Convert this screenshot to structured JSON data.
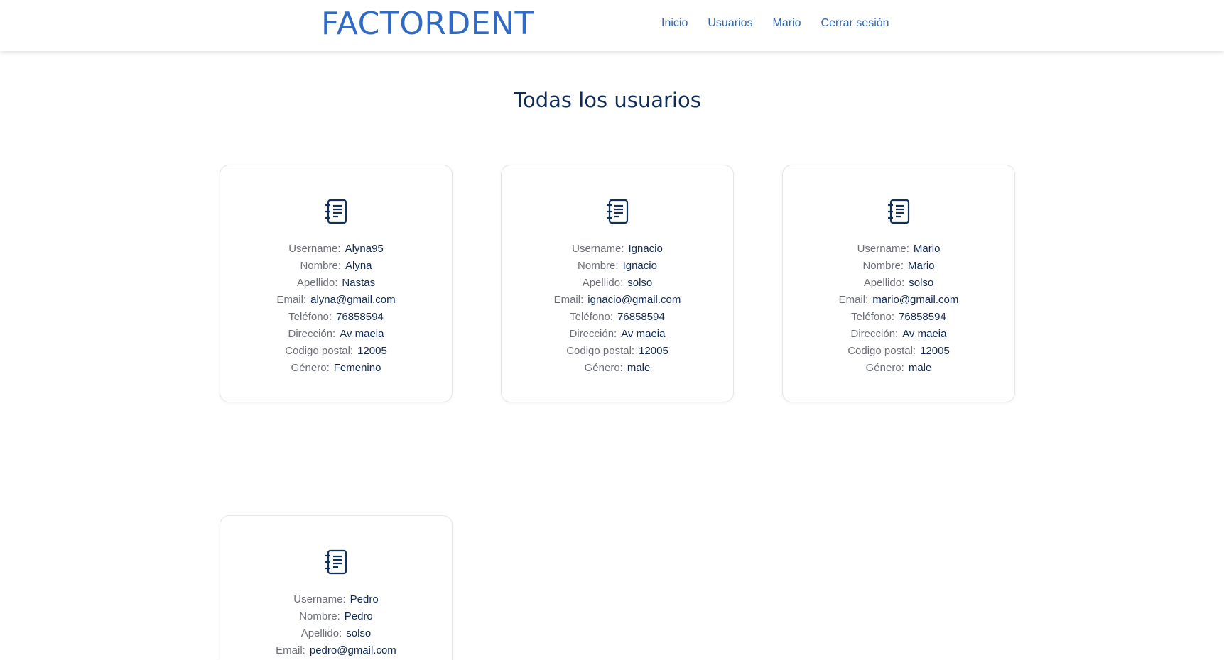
{
  "navbar": {
    "brand": "FACTORDENT",
    "links": [
      "Inicio",
      "Usuarios",
      "Mario",
      "Cerrar sesión"
    ]
  },
  "page": {
    "title": "Todas los usuarios"
  },
  "labels": {
    "username": "Username:",
    "nombre": "Nombre:",
    "apellido": "Apellido:",
    "email": "Email:",
    "telefono": "Teléfono:",
    "direccion": "Dirección:",
    "codigo_postal": "Codigo postal:",
    "genero": "Género:"
  },
  "users": [
    {
      "username": "Alyna95",
      "nombre": "Alyna",
      "apellido": "Nastas",
      "email": "alyna@gmail.com",
      "telefono": "76858594",
      "direccion": "Av maeia",
      "codigo_postal": "12005",
      "genero": "Femenino"
    },
    {
      "username": "Ignacio",
      "nombre": "Ignacio",
      "apellido": "solso",
      "email": "ignacio@gmail.com",
      "telefono": "76858594",
      "direccion": "Av maeia",
      "codigo_postal": "12005",
      "genero": "male"
    },
    {
      "username": "Mario",
      "nombre": "Mario",
      "apellido": "solso",
      "email": "mario@gmail.com",
      "telefono": "76858594",
      "direccion": "Av maeia",
      "codigo_postal": "12005",
      "genero": "male"
    },
    {
      "username": "Pedro",
      "nombre": "Pedro",
      "apellido": "solso",
      "email": "pedro@gmail.com"
    }
  ],
  "icons": {
    "card_icon": "notebook-icon"
  },
  "colors": {
    "brand": "#2f6bc6",
    "nav_link": "#2f64b4",
    "title": "#0f2c57",
    "value": "#102a55",
    "label": "#6b6f76"
  }
}
